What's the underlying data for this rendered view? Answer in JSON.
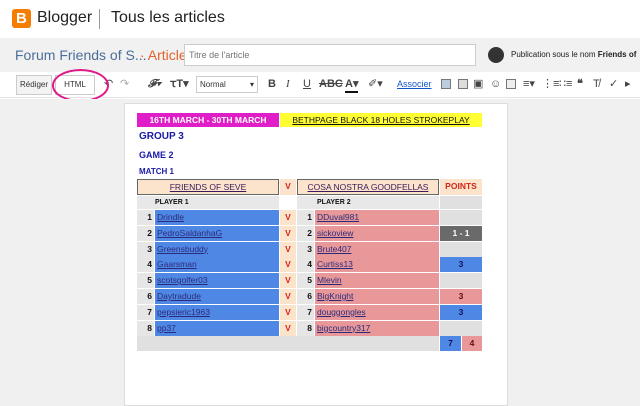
{
  "app": {
    "brand": "Blogger",
    "breadcrumb": "Tous les articles"
  },
  "post": {
    "blog_title": "Forum Friends of S...",
    "separator": "·",
    "kind": "Article",
    "title_placeholder": "Titre de l'article",
    "publish_as": "Publication sous le nom",
    "publish_name": "Friends of"
  },
  "toolbar": {
    "compose_label": "Rédiger",
    "html_label": "HTML",
    "format_value": "Normal",
    "link_label": "Associer"
  },
  "table": {
    "date_range": "16TH MARCH - 30TH MARCH",
    "event": "BETHPAGE BLACK 18 HOLES STROKEPLAY",
    "group": "GROUP 3",
    "game": "GAME 2",
    "match": "MATCH 1",
    "team1": "FRIENDS OF SEVE",
    "vs": "V",
    "team2": "COSA NOSTRA GOODFELLAS",
    "points_header": "POINTS",
    "player1_header": "PLAYER 1",
    "player2_header": "PLAYER 2",
    "rows": [
      {
        "n1": "1",
        "p1": "Drindle",
        "v": "V",
        "n2": "1",
        "p2": "DDuval981",
        "pts": ""
      },
      {
        "n1": "2",
        "p1": "PedroSaldanhaG",
        "v": "V",
        "n2": "2",
        "p2": "sickoview",
        "pts": "1 - 1"
      },
      {
        "n1": "3",
        "p1": "Greensbuddy",
        "v": "V",
        "n2": "3",
        "p2": "Brute407",
        "pts": ""
      },
      {
        "n1": "4",
        "p1": "Gaarsman",
        "v": "V",
        "n2": "4",
        "p2": "Curtiss13",
        "pts": "3"
      },
      {
        "n1": "5",
        "p1": "scotsgolfer03",
        "v": "V",
        "n2": "5",
        "p2": "Mlevin",
        "pts": ""
      },
      {
        "n1": "6",
        "p1": "Daytradude",
        "v": "V",
        "n2": "6",
        "p2": "BigKnight",
        "pts": "3"
      },
      {
        "n1": "7",
        "p1": "pepsieric1963",
        "v": "V",
        "n2": "7",
        "p2": "douggongles",
        "pts": "3"
      },
      {
        "n1": "8",
        "p1": "pp37",
        "v": "V",
        "n2": "8",
        "p2": "bigcountry317",
        "pts": ""
      }
    ],
    "total_team1": "7",
    "total_team2": "4"
  },
  "colors": {
    "accent": "#f57d00",
    "annotation": "#e0198a",
    "team1_fill": "#4f87e4",
    "team2_fill": "#e89898"
  }
}
